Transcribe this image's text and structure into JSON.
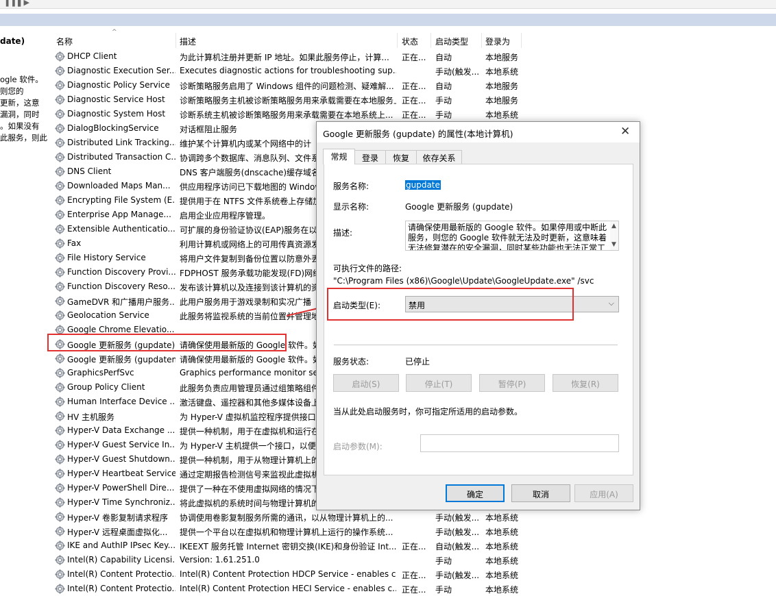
{
  "left_panel": {
    "title_fragment": "date)",
    "desc_lines": [
      "ogle 软件。",
      "则您的",
      "更新，这意",
      "漏洞，同时",
      "。如果没有",
      "此服务，则此"
    ]
  },
  "columns": {
    "name": "名称",
    "desc": "描述",
    "status": "状态",
    "startup": "启动类型",
    "logon": "登录为"
  },
  "services": [
    {
      "name": "DHCP Client",
      "desc": "为此计算机注册并更新 IP 地址。如果此服务停止，计算...",
      "status": "正在...",
      "startup": "自动",
      "logon": "本地服务"
    },
    {
      "name": "Diagnostic Execution Ser...",
      "desc": "Executes diagnostic actions for troubleshooting sup...",
      "status": "",
      "startup": "手动(触发...",
      "logon": "本地系统"
    },
    {
      "name": "Diagnostic Policy Service",
      "desc": "诊断策略服务启用了 Windows 组件的问题检测、疑难解...",
      "status": "正在...",
      "startup": "自动",
      "logon": "本地服务"
    },
    {
      "name": "Diagnostic Service Host",
      "desc": "诊断策略服务主机被诊断策略服务用来承载需要在本地服务上...",
      "status": "正在...",
      "startup": "手动",
      "logon": "本地服务"
    },
    {
      "name": "Diagnostic System Host",
      "desc": "诊断系统主机被诊断策略服务用来承载需要在本地系统上...",
      "status": "正在...",
      "startup": "手动",
      "logon": "本地系统"
    },
    {
      "name": "DialogBlockingService",
      "desc": "对话框阻止服务",
      "status": "",
      "startup": "",
      "logon": ""
    },
    {
      "name": "Distributed Link Tracking...",
      "desc": "维护某个计算机内或某个网络中的计",
      "status": "",
      "startup": "",
      "logon": ""
    },
    {
      "name": "Distributed Transaction C...",
      "desc": "协调跨多个数据库、消息队列、文件系",
      "status": "",
      "startup": "",
      "logon": ""
    },
    {
      "name": "DNS Client",
      "desc": "DNS 客户端服务(dnscache)缓存域名",
      "status": "",
      "startup": "",
      "logon": ""
    },
    {
      "name": "Downloaded Maps Man...",
      "desc": "供应用程序访问已下载地图的 Window",
      "status": "",
      "startup": "",
      "logon": ""
    },
    {
      "name": "Encrypting File System (E...",
      "desc": "提供用于在 NTFS 文件系统卷上存储加",
      "status": "",
      "startup": "",
      "logon": ""
    },
    {
      "name": "Enterprise App Manage...",
      "desc": "启用企业应用程序管理。",
      "status": "",
      "startup": "",
      "logon": ""
    },
    {
      "name": "Extensible Authenticatio...",
      "desc": "可扩展的身份验证协议(EAP)服务在以",
      "status": "",
      "startup": "",
      "logon": ""
    },
    {
      "name": "Fax",
      "desc": "利用计算机或网络上的可用传真资源发",
      "status": "",
      "startup": "",
      "logon": ""
    },
    {
      "name": "File History Service",
      "desc": "将用户文件复制到备份位置以防意外丢",
      "status": "",
      "startup": "",
      "logon": ""
    },
    {
      "name": "Function Discovery Provi...",
      "desc": "FDPHOST 服务承载功能发现(FD)网络",
      "status": "",
      "startup": "",
      "logon": ""
    },
    {
      "name": "Function Discovery Reso...",
      "desc": "发布该计算机以及连接到该计算机的资",
      "status": "",
      "startup": "",
      "logon": ""
    },
    {
      "name": "GameDVR 和广播用户服务...",
      "desc": "此用户服务用于游戏录制和实况广播",
      "status": "",
      "startup": "",
      "logon": ""
    },
    {
      "name": "Geolocation Service",
      "desc": "此服务将监视系统的当前位置并管理地",
      "status": "",
      "startup": "",
      "logon": ""
    },
    {
      "name": "Google Chrome Elevatio...",
      "desc": "",
      "status": "",
      "startup": "",
      "logon": ""
    },
    {
      "name": "Google 更新服务 (gupdate)",
      "desc": "请确保使用最新版的 Google 软件。如",
      "status": "",
      "startup": "",
      "logon": ""
    },
    {
      "name": "Google 更新服务 (gupdatem)",
      "desc": "请确保使用最新版的 Google 软件。如",
      "status": "",
      "startup": "",
      "logon": ""
    },
    {
      "name": "GraphicsPerfSvc",
      "desc": "Graphics performance monitor ser",
      "status": "",
      "startup": "",
      "logon": ""
    },
    {
      "name": "Group Policy Client",
      "desc": "此服务负责应用管理员通过组策略组件",
      "status": "",
      "startup": "",
      "logon": ""
    },
    {
      "name": "Human Interface Device ...",
      "desc": "激活键盘、遥控器和其他多媒体设备上",
      "status": "",
      "startup": "",
      "logon": ""
    },
    {
      "name": "HV 主机服务",
      "desc": "为 Hyper-V 虚拟机监控程序提供接口",
      "status": "",
      "startup": "",
      "logon": ""
    },
    {
      "name": "Hyper-V Data Exchange ...",
      "desc": "提供一种机制，用于在虚拟机和运行在",
      "status": "",
      "startup": "",
      "logon": ""
    },
    {
      "name": "Hyper-V Guest Service In...",
      "desc": "为 Hyper-V 主机提供一个接口，以便",
      "status": "",
      "startup": "",
      "logon": ""
    },
    {
      "name": "Hyper-V Guest Shutdown...",
      "desc": "提供一种机制，用于从物理计算机上的",
      "status": "",
      "startup": "",
      "logon": ""
    },
    {
      "name": "Hyper-V Heartbeat Service",
      "desc": "通过定期报告检测信号来监视此虚拟机",
      "status": "",
      "startup": "",
      "logon": ""
    },
    {
      "name": "Hyper-V PowerShell Dire...",
      "desc": "提供了一种在不使用虚拟网络的情况下",
      "status": "",
      "startup": "",
      "logon": ""
    },
    {
      "name": "Hyper-V Time Synchroniz...",
      "desc": "将此虚拟机的系统时间与物理计算机的",
      "status": "",
      "startup": "",
      "logon": ""
    },
    {
      "name": "Hyper-V 卷影复制请求程序",
      "desc": "协调使用卷影复制服务所需的通讯，以从物理计算机上的...",
      "status": "",
      "startup": "手动(触发...",
      "logon": "本地系统"
    },
    {
      "name": "Hyper-V 远程桌面虚拟化...",
      "desc": "提供一个平台以在虚拟机和物理计算机上运行的操作系统...",
      "status": "",
      "startup": "手动(触发...",
      "logon": "本地系统"
    },
    {
      "name": "IKE and AuthIP IPsec Key...",
      "desc": "IKEEXT 服务托管 Internet 密钥交换(IKE)和身份验证 Int...",
      "status": "正在...",
      "startup": "自动(触发...",
      "logon": "本地系统"
    },
    {
      "name": "Intel(R) Capability Licensi...",
      "desc": "Version: 1.61.251.0",
      "status": "",
      "startup": "手动",
      "logon": "本地系统"
    },
    {
      "name": "Intel(R) Content Protectio...",
      "desc": "Intel(R) Content Protection HDCP Service - enables c...",
      "status": "正在...",
      "startup": "手动(触发...",
      "logon": "本地系统"
    },
    {
      "name": "Intel(R) Content Protectio...",
      "desc": "Intel(R) Content Protection HECI Service - enables c...",
      "status": "正在...",
      "startup": "手动",
      "logon": "本地系统"
    }
  ],
  "dialog": {
    "title": "Google 更新服务 (gupdate) 的属性(本地计算机)",
    "tabs": [
      "常规",
      "登录",
      "恢复",
      "依存关系"
    ],
    "service_name_label": "服务名称:",
    "service_name_value": "gupdate",
    "display_name_label": "显示名称:",
    "display_name_value": "Google 更新服务 (gupdate)",
    "desc_label": "描述:",
    "desc_value": "请确保使用最新版的 Google 软件。如果停用或中断此服务，则您的 Google 软件就无法及时更新，这意味着无法修复潜在的安全漏洞，同时某些功能也无法正常工作。",
    "path_label": "可执行文件的路径:",
    "path_value": "\"C:\\Program Files (x86)\\Google\\Update\\GoogleUpdate.exe\" /svc",
    "startup_label": "启动类型(E):",
    "startup_value": "禁用",
    "status_label": "服务状态:",
    "status_value": "已停止",
    "buttons": {
      "start": "启动(S)",
      "stop": "停止(T)",
      "pause": "暂停(P)",
      "resume": "恢复(R)"
    },
    "hint": "当从此处启动服务时，你可指定所适用的启动参数。",
    "param_label": "启动参数(M):",
    "ok": "确定",
    "cancel": "取消",
    "apply": "应用(A)"
  }
}
